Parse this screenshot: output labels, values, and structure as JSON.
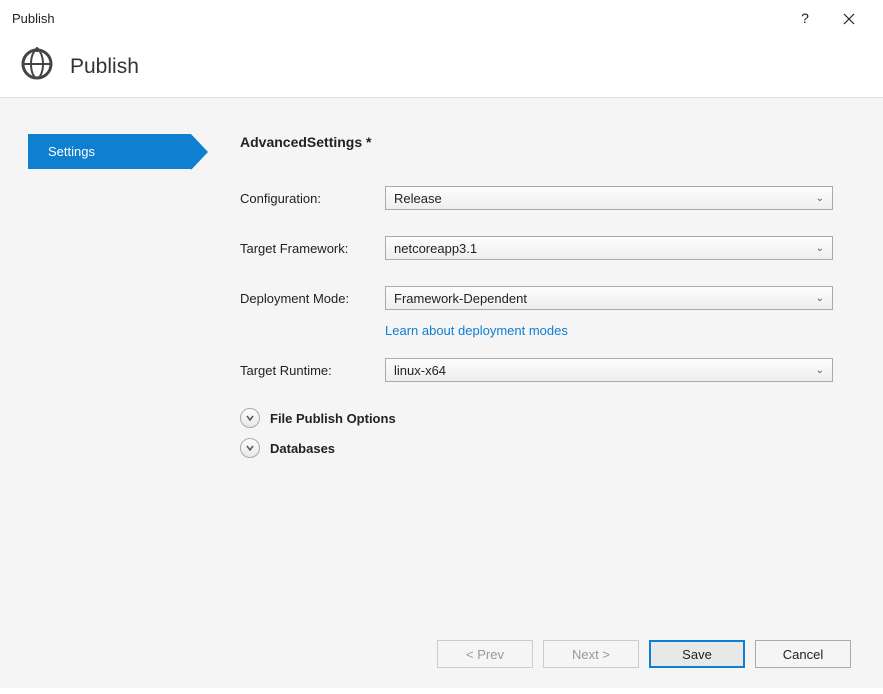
{
  "titlebar": {
    "title": "Publish",
    "help": "?"
  },
  "header": {
    "title": "Publish"
  },
  "sidebar": {
    "items": [
      {
        "label": "Settings"
      }
    ]
  },
  "main": {
    "heading": "AdvancedSettings *",
    "fields": {
      "configuration": {
        "label": "Configuration:",
        "value": "Release"
      },
      "target_framework": {
        "label": "Target Framework:",
        "value": "netcoreapp3.1"
      },
      "deployment_mode": {
        "label": "Deployment Mode:",
        "value": "Framework-Dependent",
        "link": "Learn about deployment modes"
      },
      "target_runtime": {
        "label": "Target Runtime:",
        "value": "linux-x64"
      }
    },
    "expandables": {
      "file_publish": "File Publish Options",
      "databases": "Databases"
    }
  },
  "buttons": {
    "prev": "< Prev",
    "next": "Next >",
    "save": "Save",
    "cancel": "Cancel"
  }
}
